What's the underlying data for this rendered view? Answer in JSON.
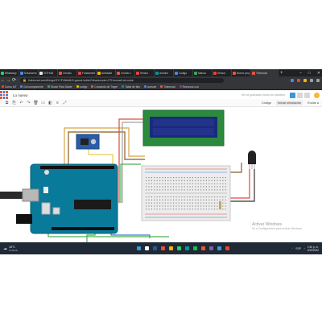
{
  "browser": {
    "tabs": [
      {
        "label": "WhatsApp",
        "color": "#25d366",
        "active": false
      },
      {
        "label": "Soluciones",
        "color": "#4a86e8",
        "active": false
      },
      {
        "label": "GITHUB",
        "color": "#e6e6e6",
        "active": false
      },
      {
        "label": "Circuito",
        "color": "#e4573d",
        "active": false
      },
      {
        "label": "Fundamentos",
        "color": "#ea4335",
        "active": false
      },
      {
        "label": "Actividad",
        "color": "#f4b400",
        "active": false
      },
      {
        "label": "Circuito 3",
        "color": "#e4573d",
        "active": false
      },
      {
        "label": "Sensor",
        "color": "#ea4335",
        "active": false
      },
      {
        "label": "Arduino",
        "color": "#00979d",
        "active": false
      },
      {
        "label": "Codigo",
        "color": "#4a86e8",
        "active": false
      },
      {
        "label": "Manual",
        "color": "#34a853",
        "active": false
      },
      {
        "label": "Sensor",
        "color": "#ea4335",
        "active": false
      },
      {
        "label": "Nuevo proyecto",
        "color": "#e4573d",
        "active": false
      },
      {
        "label": "Tinkercad",
        "color": "#e4573d",
        "active": true
      }
    ],
    "new_tab": "+",
    "window_controls": [
      "–",
      "□",
      "✕"
    ],
    "url": "tinkercad.com/things/3YYF4Nfn8L5-grand-/editel?sharecode=C7Hmuna0-uh-cube",
    "nav": [
      "←",
      "→",
      "⟳"
    ],
    "bookmarks": [
      {
        "label": "Curso IoT",
        "color": "#ea4335"
      },
      {
        "label": "Dot componente",
        "color": "#4a86e8"
      },
      {
        "label": "Ebook Para Saber",
        "color": "#34a853"
      },
      {
        "label": "codigo",
        "color": "#f4b400"
      },
      {
        "label": "Comando de Tinger",
        "color": "#e4573d"
      },
      {
        "label": "Tabla de bits",
        "color": "#00979d"
      },
      {
        "label": "console",
        "color": "#4a86e8"
      },
      {
        "label": "Tinkercad",
        "color": "#e4573d"
      },
      {
        "label": "Recursos cod",
        "color": "#9c27b0"
      }
    ]
  },
  "app": {
    "title": "Lo nuevo",
    "saved_text": "Se ha guardado todos los cambios",
    "toolbar": {
      "tools": [
        "⧉",
        "⎘",
        "↶",
        "↷",
        "🗑",
        "▭",
        "◧",
        "≡",
        "⤢"
      ],
      "code_label": "Código",
      "start_sim_label": "Iniciar simulación",
      "send_label": "Enviar a"
    }
  },
  "activation": {
    "title": "Activar Windows",
    "subtitle": "Ve a Configuración para activar Windows."
  },
  "taskbar": {
    "weather_temp": "18°C",
    "weather_desc": "Nublado",
    "apps": [
      "#3a96dd",
      "#ffffff",
      "#2b579a",
      "#e74c3c",
      "#f4b400",
      "#25d366",
      "#00979d",
      "#1db954",
      "#e4573d",
      "#7b5ea7",
      "#3a96dd",
      "#ea4335"
    ],
    "tray": "ESP",
    "time": "2:40 p. m.",
    "date": "5/10/2022"
  }
}
